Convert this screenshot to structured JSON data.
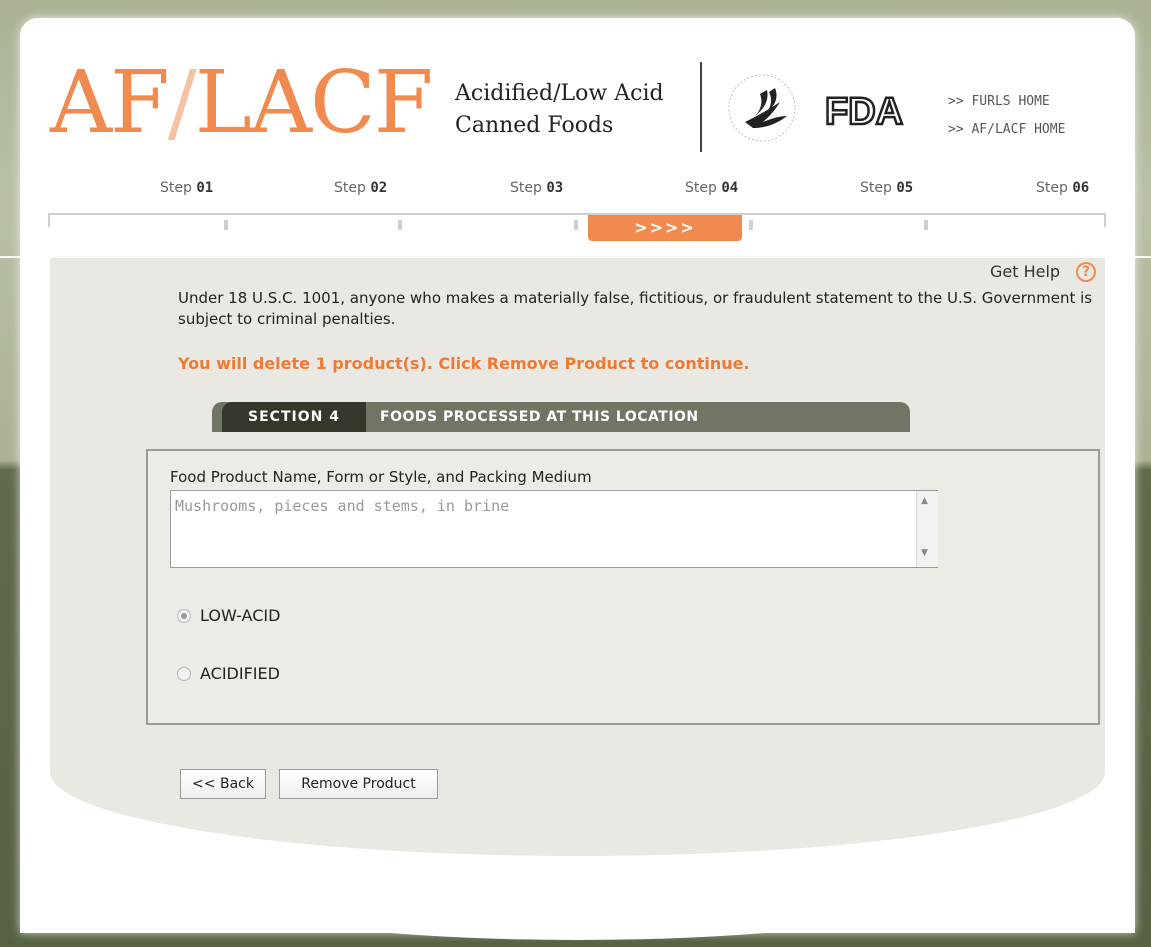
{
  "header": {
    "logo_main": "AF",
    "logo_slash": "/",
    "logo_tail": "LACF",
    "subtitle_line1": "Acidified/Low Acid",
    "subtitle_line2": "Canned Foods",
    "fda_text": "FDA",
    "links": [
      ">> FURLS HOME",
      ">> AF/LACF HOME"
    ]
  },
  "steps": [
    {
      "prefix": "Step",
      "num": "01"
    },
    {
      "prefix": "Step",
      "num": "02"
    },
    {
      "prefix": "Step",
      "num": "03"
    },
    {
      "prefix": "Step",
      "num": "04"
    },
    {
      "prefix": "Step",
      "num": "05"
    },
    {
      "prefix": "Step",
      "num": "06"
    }
  ],
  "active_step_marker": ">>>>",
  "help": {
    "label": "Get Help",
    "icon": "?"
  },
  "legal_text": "Under 18 U.S.C. 1001, anyone who makes a materially false, fictitious, or fraudulent statement to the U.S. Government is subject to criminal penalties.",
  "alert_text": "You will delete 1 product(s). Click Remove Product to continue.",
  "section": {
    "number": "SECTION 4",
    "title": "FOODS PROCESSED AT THIS LOCATION"
  },
  "form": {
    "field_label": "Food Product Name, Form or Style, and Packing Medium",
    "field_value": "Mushrooms, pieces and stems, in brine",
    "options": [
      {
        "label": "LOW-ACID",
        "checked": true
      },
      {
        "label": "ACIDIFIED",
        "checked": false
      }
    ]
  },
  "buttons": {
    "back": "<< Back",
    "remove": "Remove Product"
  },
  "colors": {
    "accent": "#f08a4f",
    "section_dark": "#32392b",
    "section_bar": "#6f7764"
  }
}
